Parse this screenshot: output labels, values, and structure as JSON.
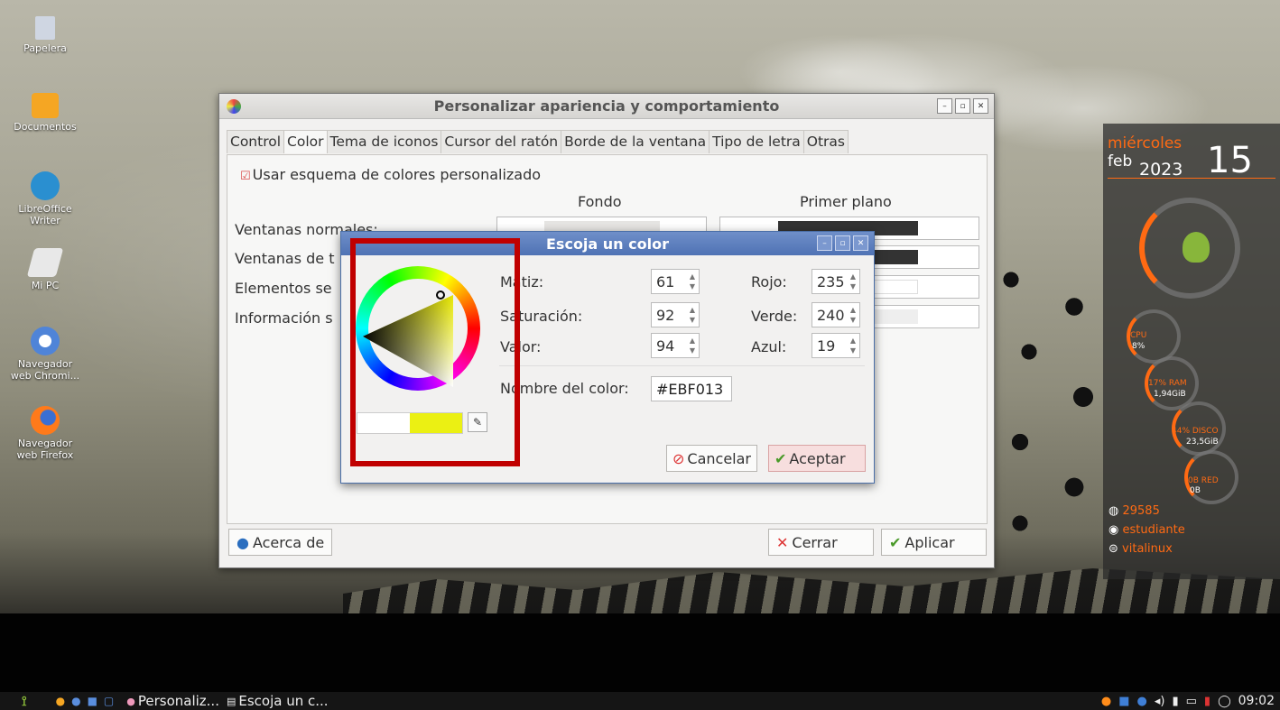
{
  "desktop": {
    "icons": [
      {
        "label": "Papelera",
        "icon": "trash-icon"
      },
      {
        "label": "Documentos",
        "icon": "folder-icon"
      },
      {
        "label": "LibreOffice Writer",
        "icon": "writer-icon"
      },
      {
        "label": "Mi PC",
        "icon": "computer-icon"
      },
      {
        "label": "Navegador web Chromi...",
        "icon": "chromium-icon"
      },
      {
        "label": "Navegador web Firefox",
        "icon": "firefox-icon"
      }
    ]
  },
  "main_window": {
    "title": "Personalizar apariencia y comportamiento",
    "tabs": [
      "Control",
      "Color",
      "Tema de iconos",
      "Cursor del ratón",
      "Borde de la ventana",
      "Tipo de letra",
      "Otras"
    ],
    "active_tab": "Color",
    "checkbox_label": "Usar esquema de colores personalizado",
    "col_background": "Fondo",
    "col_foreground": "Primer plano",
    "rows": [
      "Ventanas normales:",
      "Ventanas de t",
      "Elementos se",
      "Información s"
    ],
    "about_label": "Acerca de",
    "close_label": "Cerrar",
    "apply_label": "Aplicar"
  },
  "color_dialog": {
    "title": "Escoja un color",
    "hue_label": "Matiz:",
    "hue_value": "61",
    "saturation_label": "Saturación:",
    "saturation_value": "92",
    "value_label": "Valor:",
    "value_value": "94",
    "red_label": "Rojo:",
    "red_value": "235",
    "green_label": "Verde:",
    "green_value": "240",
    "blue_label": "Azul:",
    "blue_value": "19",
    "name_label": "Nombre del color:",
    "name_value": "#EBF013",
    "cancel_label": "Cancelar",
    "accept_label": "Aceptar",
    "current_color": "#EBF013",
    "previous_color": "#FFFFFF"
  },
  "conky": {
    "weekday": "miércoles",
    "month": "feb",
    "year": "2023",
    "day": "15",
    "cpu_label": "CPU",
    "cpu_value": "8%",
    "ram_label": "17% RAM",
    "ram_value": "1,94GiB",
    "disk_label": "44% DISCO",
    "disk_value": "23,5GiB",
    "net_label": "0B RED",
    "net_value": "0B",
    "uptime": "29585",
    "user": "estudiante",
    "host": "vitalinux"
  },
  "taskbar": {
    "tasks": [
      "Personaliz...",
      "Escoja un c..."
    ],
    "clock": "09:02"
  },
  "colors": {
    "accent_orange": "#ff6a13",
    "highlight_red": "#c00000"
  }
}
